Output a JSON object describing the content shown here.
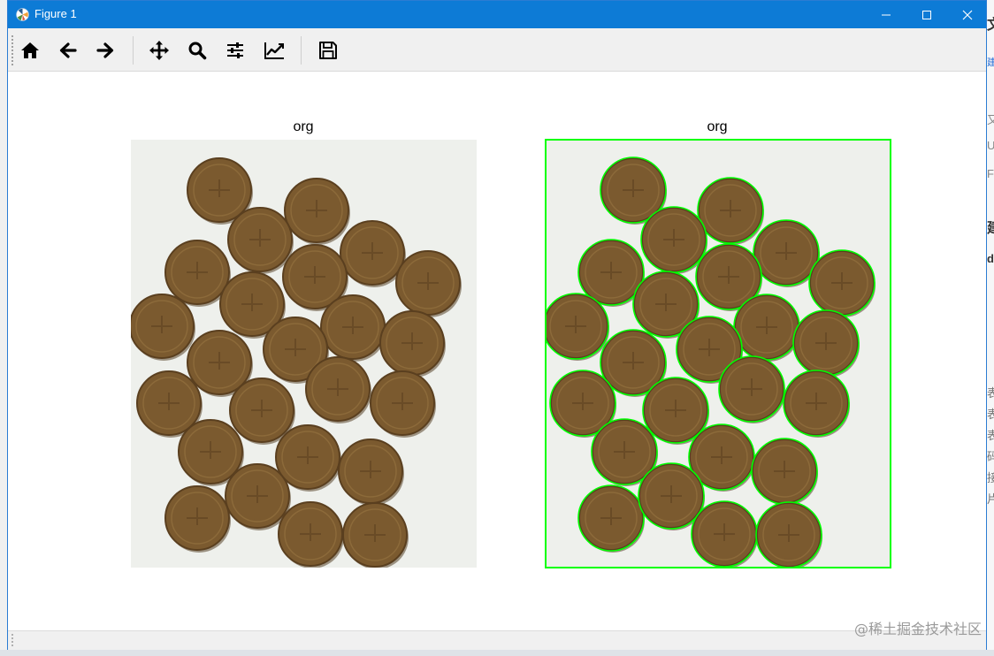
{
  "window": {
    "title": "Figure 1",
    "controls": [
      "minimize",
      "maximize",
      "close"
    ]
  },
  "toolbar": {
    "buttons": [
      {
        "name": "home",
        "icon": "home-icon"
      },
      {
        "name": "back",
        "icon": "arrow-left-icon"
      },
      {
        "name": "forward",
        "icon": "arrow-right-icon"
      },
      {
        "name": "pan",
        "icon": "move-icon"
      },
      {
        "name": "zoom",
        "icon": "magnifier-icon"
      },
      {
        "name": "configure-subplots",
        "icon": "sliders-icon"
      },
      {
        "name": "edit-axes",
        "icon": "line-chart-icon"
      },
      {
        "name": "save",
        "icon": "floppy-disk-icon"
      }
    ]
  },
  "figure": {
    "left_axes": {
      "title": "org"
    },
    "right_axes": {
      "title": "org"
    },
    "colors": {
      "coin": "#7b5a2f",
      "coin_edge": "#5a3f1f",
      "contour": "#00ff00",
      "paper": "#eef0ec"
    }
  },
  "watermark": "@稀土掘金技术社区",
  "background_fragments": [
    "文",
    "建",
    "又",
    "U",
    "Fl",
    "建",
    "d",
    "表",
    "表",
    "表",
    "码",
    "接",
    "片"
  ]
}
